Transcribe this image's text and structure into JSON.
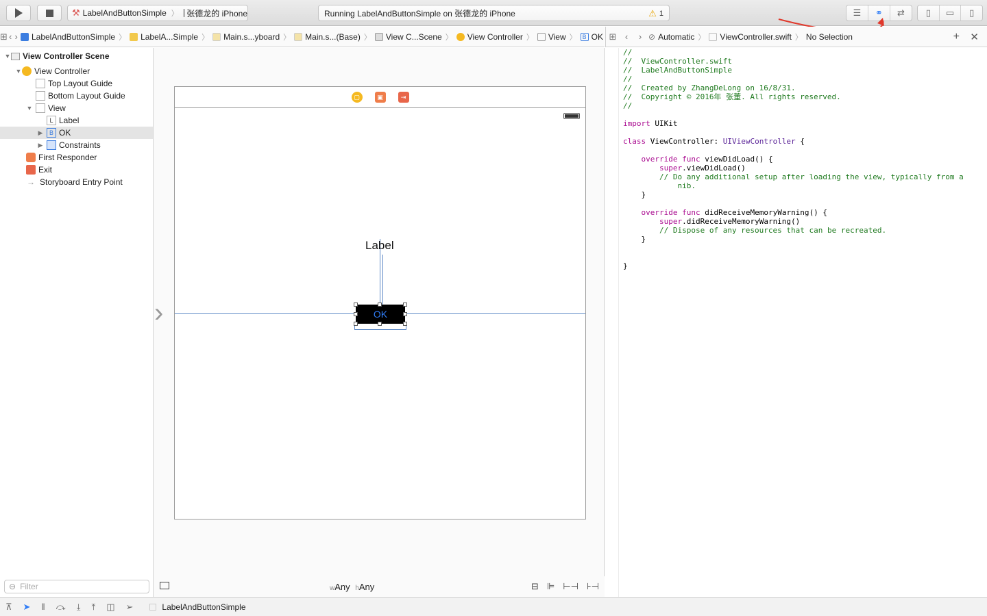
{
  "toolbar": {
    "scheme": {
      "project": "LabelAndButtonSimple",
      "device": "张德龙的 iPhone"
    },
    "status": {
      "text": "Running LabelAndButtonSimple on 张德龙的 iPhone",
      "warning_count": "1"
    }
  },
  "storyboard_jumpbar": {
    "crumbs": [
      "LabelAndButtonSimple",
      "LabelA...Simple",
      "Main.s...yboard",
      "Main.s...(Base)",
      "View C...Scene",
      "View Controller",
      "View",
      "OK"
    ]
  },
  "assistant_jumpbar": {
    "mode": "Automatic",
    "file": "ViewController.swift",
    "selection": "No Selection"
  },
  "outline": {
    "scene": "View Controller Scene",
    "view_controller": "View Controller",
    "top_layout_guide": "Top Layout Guide",
    "bottom_layout_guide": "Bottom Layout Guide",
    "view": "View",
    "label": "Label",
    "ok": "OK",
    "constraints": "Constraints",
    "first_responder": "First Responder",
    "exit": "Exit",
    "entry_point": "Storyboard Entry Point"
  },
  "filter": {
    "placeholder": "Filter"
  },
  "canvas": {
    "label_text": "Label",
    "button_text": "OK",
    "size_w": "Any",
    "size_h": "Any",
    "size_w_prefix": "w",
    "size_h_prefix": "h"
  },
  "code": {
    "lines": [
      "//",
      "//  ViewController.swift",
      "//  LabelAndButtonSimple",
      "//",
      "//  Created by ZhangDeLong on 16/8/31.",
      "//  Copyright © 2016年 张董. All rights reserved.",
      "//",
      "",
      "import UIKit",
      "",
      "class ViewController: UIViewController {",
      "",
      "    override func viewDidLoad() {",
      "        super.viewDidLoad()",
      "        // Do any additional setup after loading the view, typically from a",
      "            nib.",
      "    }",
      "",
      "    override func didReceiveMemoryWarning() {",
      "        super.didReceiveMemoryWarning()",
      "        // Dispose of any resources that can be recreated.",
      "    }",
      "",
      "",
      "}"
    ]
  },
  "bottombar": {
    "target": "LabelAndButtonSimple"
  },
  "colors": {
    "accent": "#2f7cf6",
    "annotation_arrow": "#e0382b",
    "comment": "#1f7a1f",
    "keyword": "#aa0d91"
  }
}
